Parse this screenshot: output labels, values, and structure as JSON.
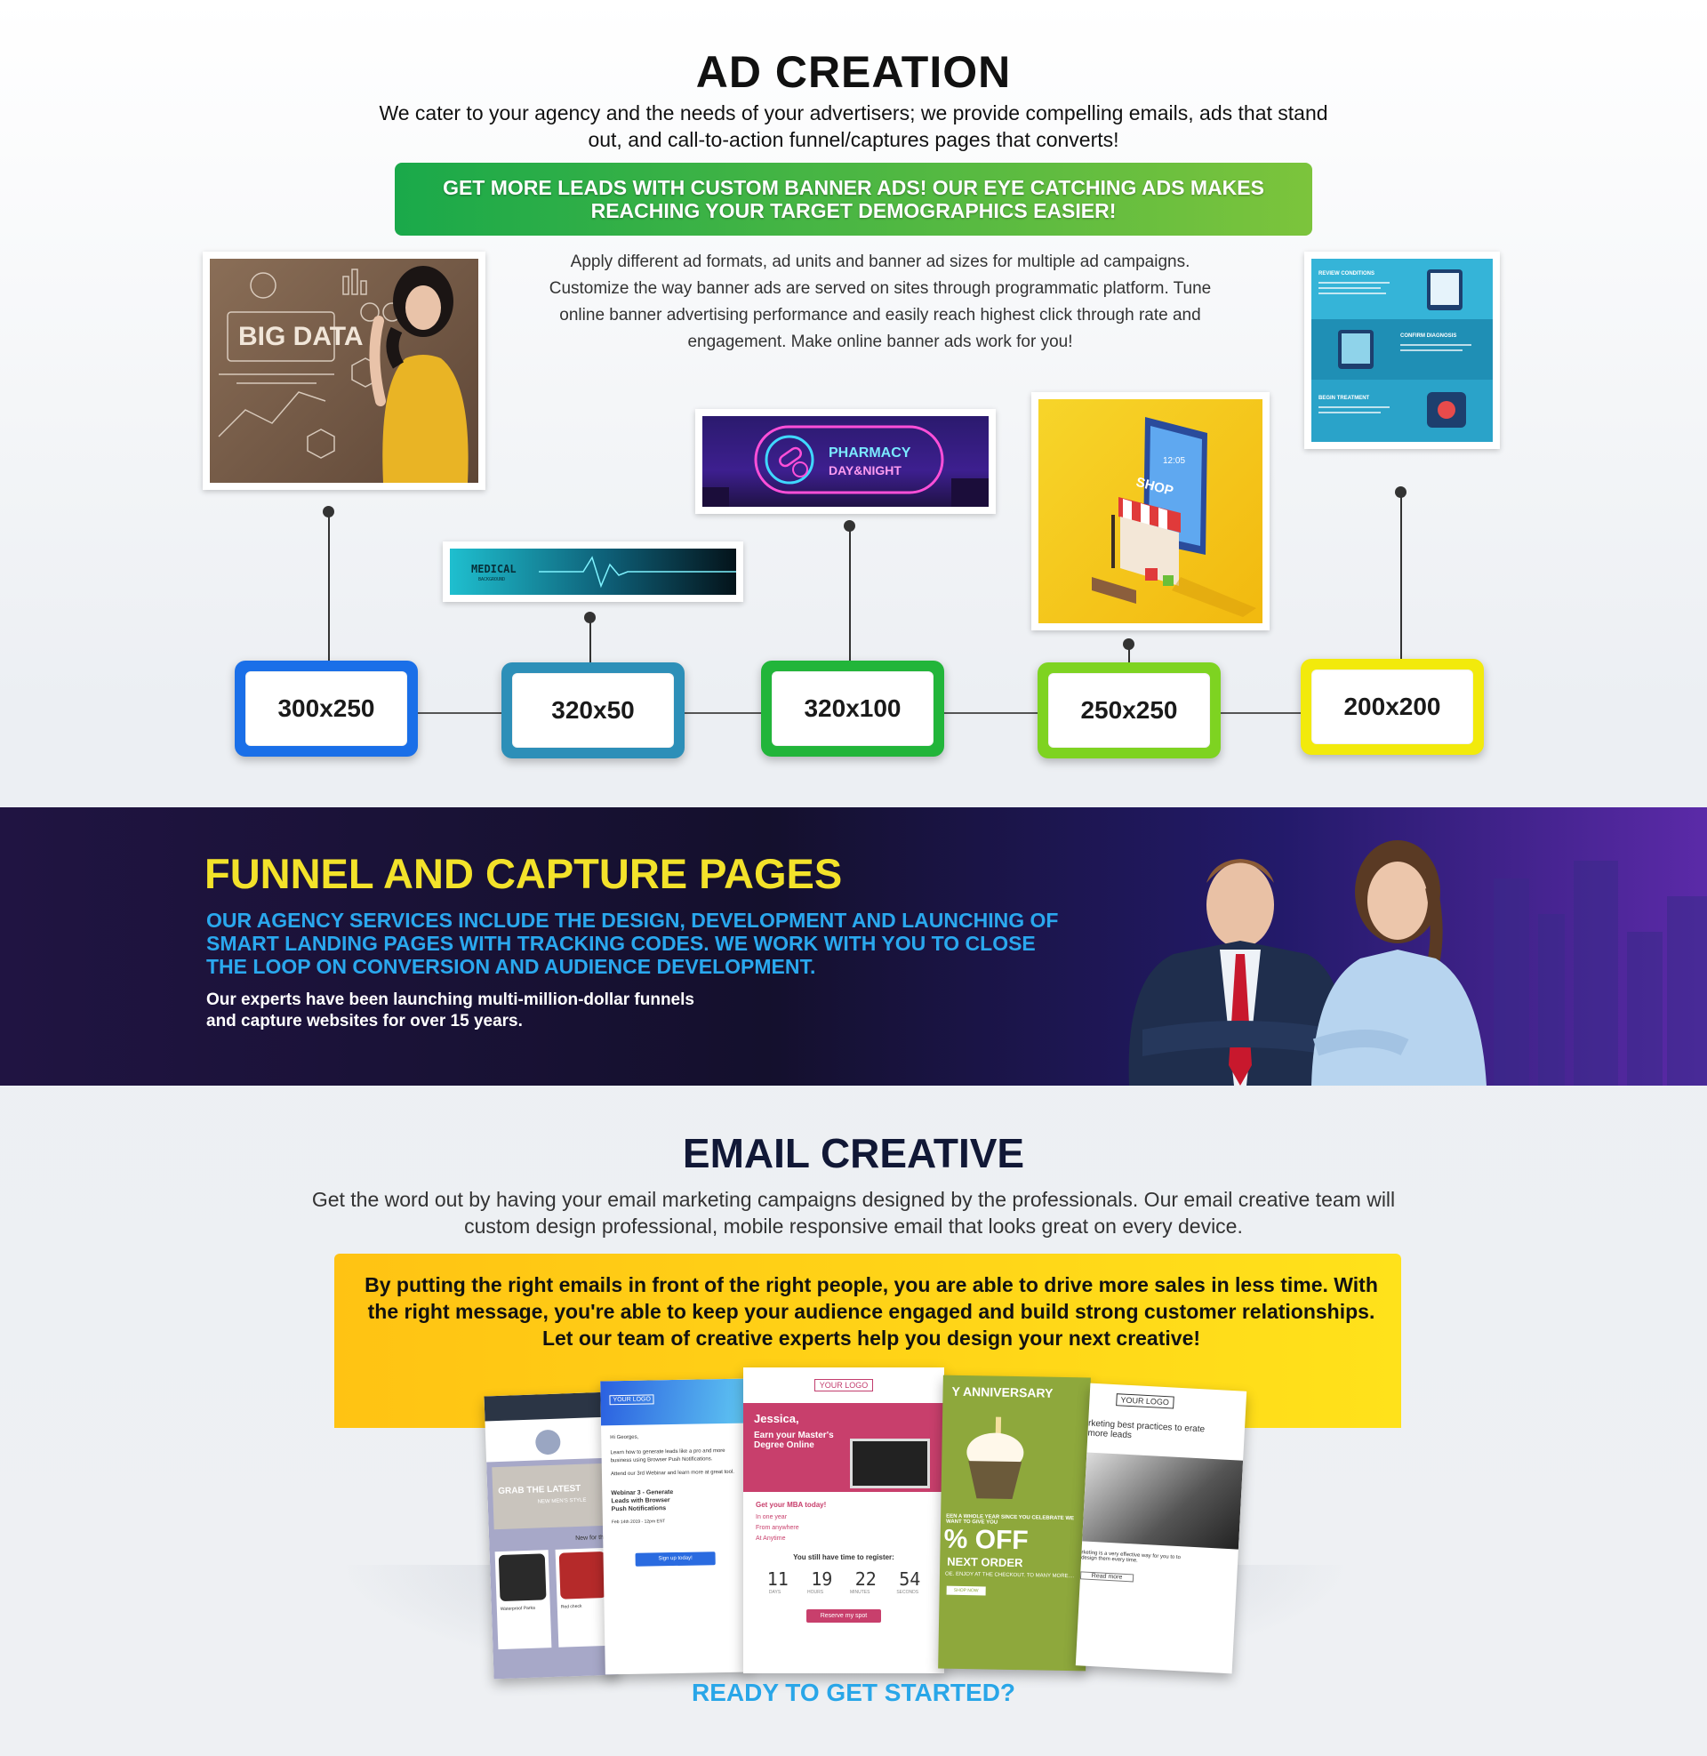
{
  "ad_creation": {
    "title": "AD CREATION",
    "intro": "We cater to your agency and the needs of your advertisers; we provide compelling emails, ads that stand out, and call-to-action funnel/captures pages that converts!",
    "banner": "GET MORE LEADS WITH CUSTOM BANNER ADS! OUR EYE CATCHING ADS MAKES REACHING YOUR TARGET DEMOGRAPHICS EASIER!",
    "description": "Apply different ad formats, ad units and banner ad sizes for multiple ad campaigns. Customize the way banner ads are served on sites through programmatic platform. Tune online banner advertising performance and easily reach highest click through rate and engagement. Make online banner ads work for you!",
    "sizes": [
      "300x250",
      "320x50",
      "320x100",
      "250x250",
      "200x200"
    ],
    "size_colors": [
      "#1a6fe8",
      "#2d8fb8",
      "#22b53a",
      "#7ed321",
      "#f2ea0c"
    ],
    "ads": {
      "big_data": "BIG DATA",
      "medical": "MEDICAL",
      "medical_sub": "BACKGROUND",
      "pharmacy": "PHARMACY",
      "pharmacy_sub": "DAY&NIGHT",
      "shop": "SHOP",
      "clock": "12:05",
      "info_steps": [
        "REVIEW CONDITIONS",
        "CONFIRM DIAGNOSIS",
        "BEGIN TREATMENT"
      ]
    }
  },
  "funnel": {
    "title": "FUNNEL AND CAPTURE PAGES",
    "subtitle": "OUR AGENCY SERVICES INCLUDE THE DESIGN, DEVELOPMENT AND LAUNCHING OF SMART LANDING PAGES WITH TRACKING CODES. WE WORK WITH YOU TO CLOSE THE LOOP ON CONVERSION AND AUDIENCE DEVELOPMENT.",
    "body": "Our experts have been launching multi-million-dollar funnels and capture websites for over 15 years."
  },
  "email": {
    "title": "EMAIL CREATIVE",
    "intro": "Get the word out by having your email marketing campaigns designed by the professionals. Our email creative team will custom design professional, mobile responsive email that looks great on every device.",
    "band_text": "By putting the right emails in front of the right people, you are able to drive more sales in less time. With the right message, you're able to keep your audience engaged and build strong customer relationships. Let our team of creative experts help you design your next creative!",
    "mock1": {
      "headline": "GRAB THE LATEST",
      "sub": "NEW MEN'S STYLE",
      "row": "New for this",
      "p1": "Waterproof Parka",
      "p2": "Red check"
    },
    "mock2": {
      "logo": "YOUR LOGO",
      "greet": "Hi Georges,",
      "text1": "Learn how to generate leads like a pro and more business using Browser Push Notifications.",
      "text2": "Attend our 3rd Webinar and learn more at great tool.",
      "webinar": "Webinar 3 - Generate Leads with Browser Push Notifications",
      "date": "Feb 14th 2019 - 12pm EST",
      "button": "Sign up today!"
    },
    "mock3": {
      "logo": "YOUR LOGO",
      "name": "Jessica,",
      "headline": "Earn your Master's Degree Online",
      "mba": "Get your MBA today!",
      "bullets": [
        "In one year",
        "From anywhere",
        "At Anytime"
      ],
      "register": "You still have time to register:",
      "timer": [
        "11",
        "19",
        "22",
        "54"
      ],
      "timer_labels": [
        "DAYS",
        "HOURS",
        "MINUTES",
        "SECONDS"
      ],
      "button": "Reserve my spot"
    },
    "mock4": {
      "title": "Y ANNIVERSARY",
      "line1": "EEN A WHOLE YEAR SINCE YOU CELEBRATE WE WANT TO GIVE YOU",
      "off": "% OFF",
      "next": "NEXT ORDER",
      "line2": "OE. ENJOY AT THE CHECKOUT. TO MANY MORE....",
      "button": "SHOP NOW"
    },
    "mock5": {
      "logo": "YOUR LOGO",
      "headline": "rketing best practices to erate more leads",
      "text": "rketing is a very effective way for you to to design them every time.",
      "button": "Read more"
    }
  },
  "cta": "READY TO GET STARTED?"
}
